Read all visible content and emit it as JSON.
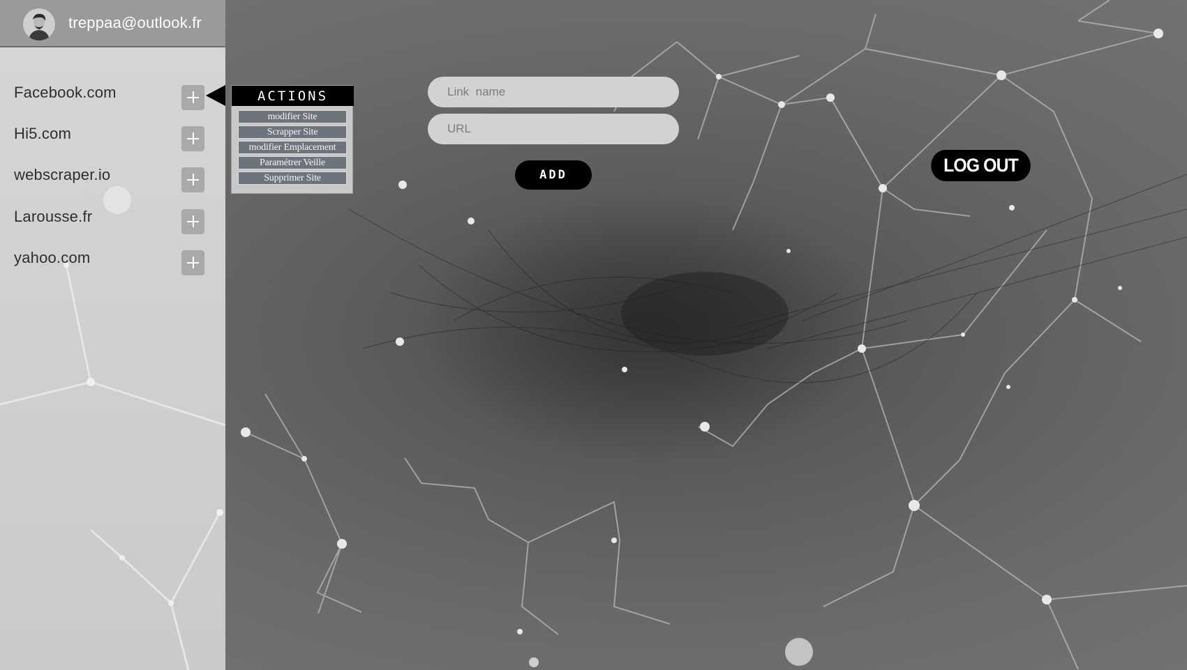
{
  "user": {
    "email": "treppaa@outlook.fr"
  },
  "sidebar": {
    "sites": [
      {
        "label": "Facebook.com"
      },
      {
        "label": "Hi5.com"
      },
      {
        "label": "webscraper.io"
      },
      {
        "label": "Larousse.fr"
      },
      {
        "label": "yahoo.com"
      }
    ]
  },
  "actions": {
    "title": "ACTIONS",
    "items": [
      {
        "label": "modifier Site"
      },
      {
        "label": "Scrapper Site"
      },
      {
        "label": "modifier Emplacement"
      },
      {
        "label": "Paramétrer Veille"
      },
      {
        "label": "Supprimer Site"
      }
    ]
  },
  "form": {
    "link_name_placeholder": "Link  name",
    "url_placeholder": "URL",
    "add_label": "ADD"
  },
  "header": {
    "logout_label": "LOG OUT"
  },
  "colors": {
    "background": "#5e5e5e",
    "sidebar": "#d0d0d0",
    "accent": "#000000"
  },
  "icons": {
    "add_site": "plus-icon",
    "avatar": "user-avatar"
  }
}
